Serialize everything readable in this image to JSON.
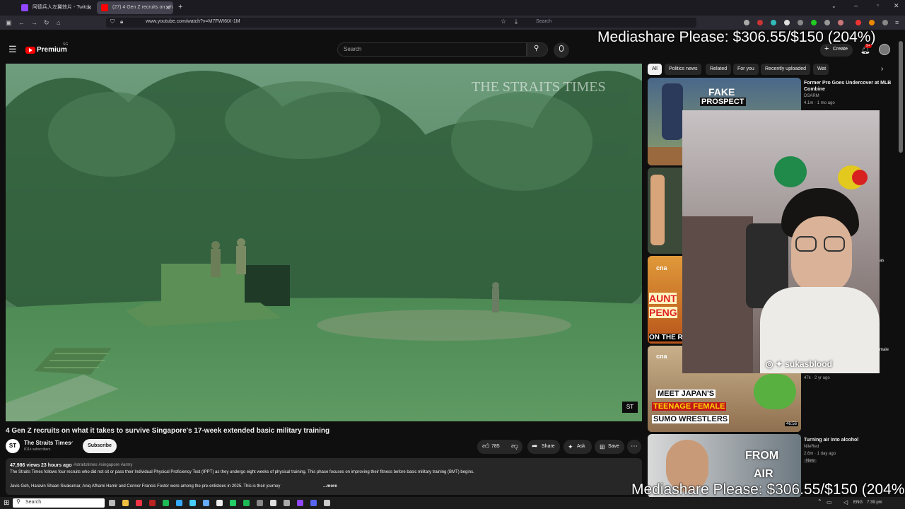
{
  "browser": {
    "tabs": [
      {
        "label": "阿德兵人左翼效片 - Twitch",
        "active": false
      },
      {
        "label": "(27) 4 Gen Z recruits on wh",
        "active": true
      }
    ],
    "url": "www.youtube.com/watch?v=M7FWI6tX-1M",
    "search_placeholder": "Search"
  },
  "youtube": {
    "logo": "Premium",
    "logo_badge": "SG",
    "search_placeholder": "Search",
    "create_label": "Create",
    "notif_count": "9+",
    "video": {
      "watermark": "THE STRAITS TIMES",
      "corner_logo": "ST",
      "title": "4 Gen Z recruits on what it takes to survive Singapore's 17-week extended basic military training",
      "channel_name": "The Straits Times",
      "subscribers": "811k subscribers",
      "subscribe_label": "Subscribe",
      "likes": "785",
      "share_label": "Share",
      "ask_label": "Ask",
      "save_label": "Save",
      "views": "47,986 views",
      "age": "23 hours ago",
      "hashtags": "#straitstimes #singapore #army",
      "description": "The Straits Times follows four recruits who did not sit or pass their Individual Physical Proficiency Test (IPPT) as they undergo eight weeks of physical training. This phase focuses on improving their fitness before basic military training (BMT) begins.",
      "description2": "Javis Goh, Haravin Shaan Sivakumar, Aniq Afhami Hamir and Connor Francis Foster were among the pre-enlistees in 2025. This is their journey",
      "more_label": "...more"
    },
    "chips": [
      "All",
      "Politics news",
      "Related",
      "For you",
      "Recently uploaded",
      "Wat"
    ],
    "recommendations": [
      {
        "title": "Former Pro Goes Undercover at MLB Combine",
        "channel": "DSARM",
        "meta": "4.1m · 1 mo ago",
        "thumb_text1": "FAKE",
        "thumb_text2": "PROSPECT"
      },
      {
        "title": "",
        "channel": "",
        "meta": "",
        "thumb_text1": "",
        "thumb_text2": ""
      },
      {
        "title": "",
        "channel": "",
        "meta": "",
        "thumb_text1": "AUNT",
        "thumb_text2": "PENG",
        "thumb_text3": "ON THE RED",
        "logo": "cna"
      },
      {
        "title": "",
        "channel": "",
        "meta": "47k · 2 yr ago",
        "thumb_text1": "MEET JAPAN'S",
        "thumb_text2": "TEENAGE FEMALE",
        "thumb_text3": "SUMO WRESTLERS",
        "duration": "46:56",
        "logo": "cna"
      },
      {
        "title": "Turning air into alcohol",
        "channel": "NileRed",
        "meta": "2.6m · 1 day ago",
        "badge": "New",
        "thumb_text1": "FROM",
        "thumb_text2": "AIR"
      }
    ],
    "side_fragments": [
      "as",
      "male"
    ]
  },
  "overlay": {
    "mediashare_top": "Mediashare Please: $306.55/$150 (204%)",
    "mediashare_bottom": "Mediashare Please: $306.55/$150 (204%)",
    "social_handle": "sukasblood"
  },
  "taskbar": {
    "search_placeholder": "Search",
    "lang": "ENG",
    "time": "7:39 pm"
  }
}
